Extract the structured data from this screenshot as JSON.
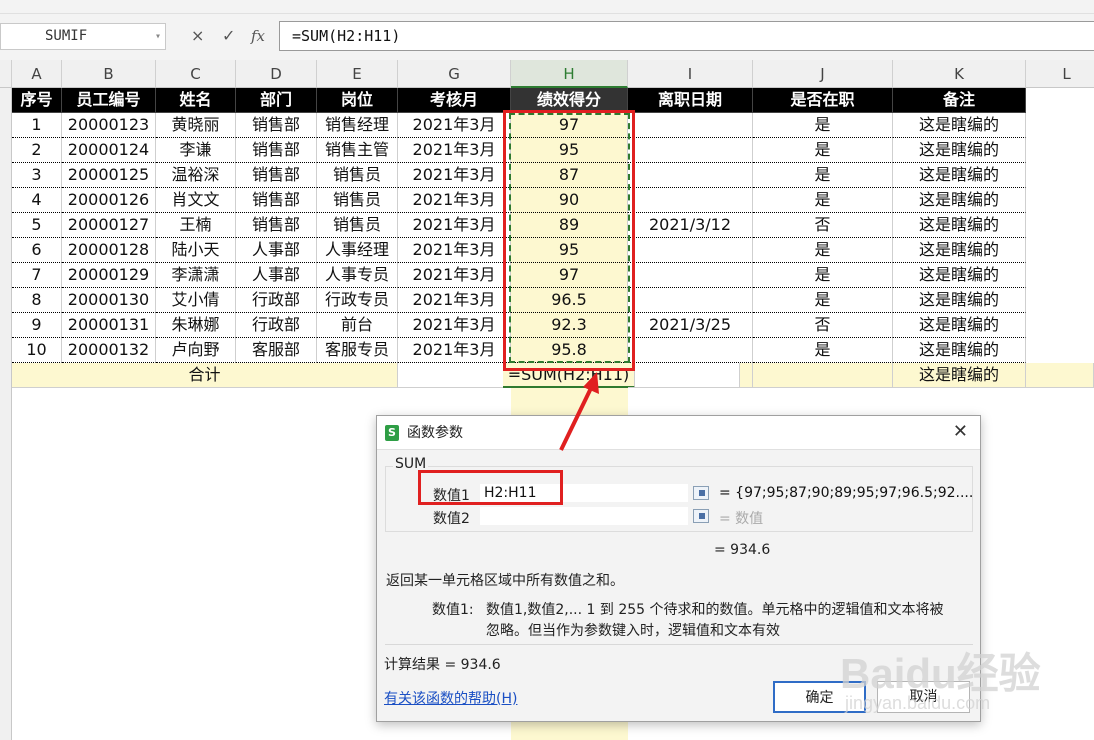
{
  "formula_bar": {
    "name_box": "SUMIF",
    "cancel_icon": "×",
    "enter_icon": "✓",
    "fx_icon": "fx",
    "formula": "=SUM(H2:H11)"
  },
  "columns": [
    "A",
    "B",
    "C",
    "D",
    "E",
    "G",
    "H",
    "I",
    "J",
    "K",
    "L"
  ],
  "headers": [
    "序号",
    "员工编号",
    "姓名",
    "部门",
    "岗位",
    "考核月",
    "绩效得分",
    "离职日期",
    "是否在职",
    "备注"
  ],
  "rows": [
    [
      "1",
      "20000123",
      "黄晓丽",
      "销售部",
      "销售经理",
      "2021年3月",
      "97",
      "",
      "是",
      "这是瞎编的"
    ],
    [
      "2",
      "20000124",
      "李谦",
      "销售部",
      "销售主管",
      "2021年3月",
      "95",
      "",
      "是",
      "这是瞎编的"
    ],
    [
      "3",
      "20000125",
      "温裕深",
      "销售部",
      "销售员",
      "2021年3月",
      "87",
      "",
      "是",
      "这是瞎编的"
    ],
    [
      "4",
      "20000126",
      "肖文文",
      "销售部",
      "销售员",
      "2021年3月",
      "90",
      "",
      "是",
      "这是瞎编的"
    ],
    [
      "5",
      "20000127",
      "王楠",
      "销售部",
      "销售员",
      "2021年3月",
      "89",
      "2021/3/12",
      "否",
      "这是瞎编的"
    ],
    [
      "6",
      "20000128",
      "陆小天",
      "人事部",
      "人事经理",
      "2021年3月",
      "95",
      "",
      "是",
      "这是瞎编的"
    ],
    [
      "7",
      "20000129",
      "李潇潇",
      "人事部",
      "人事专员",
      "2021年3月",
      "97",
      "",
      "是",
      "这是瞎编的"
    ],
    [
      "8",
      "20000130",
      "艾小倩",
      "行政部",
      "行政专员",
      "2021年3月",
      "96.5",
      "",
      "是",
      "这是瞎编的"
    ],
    [
      "9",
      "20000131",
      "朱琳娜",
      "行政部",
      "前台",
      "2021年3月",
      "92.3",
      "2021/3/25",
      "否",
      "这是瞎编的"
    ],
    [
      "10",
      "20000132",
      "卢向野",
      "客服部",
      "客服专员",
      "2021年3月",
      "95.8",
      "",
      "是",
      "这是瞎编的"
    ]
  ],
  "total_row": {
    "label": "合计",
    "formula": "=SUM(H2:H11)",
    "note": "这是瞎编的"
  },
  "dialog": {
    "title": "函数参数",
    "close_icon": "✕",
    "function_name": "SUM",
    "param1_label": "数值1",
    "param1_value": "H2:H11",
    "param1_result": "= {97;95;87;90;89;95;97;96.5;92....",
    "param2_label": "数值2",
    "param2_value": "",
    "param2_result": "= 数值",
    "formula_result_inline": "= 934.6",
    "description": "返回某一单元格区域中所有数值之和。",
    "param_help_label": "数值1:",
    "param_help_line1": "数值1,数值2,... 1 到 255 个待求和的数值。单元格中的逻辑值和文本将被",
    "param_help_line2": "忽略。但当作为参数键入时，逻辑值和文本有效",
    "calc_result": "计算结果 = 934.6",
    "help_link": "有关该函数的帮助(H)",
    "ok_button": "确定",
    "cancel_button": "取消"
  },
  "watermark": {
    "brand": "Baidu经验",
    "url": "jingyan.baidu.com"
  },
  "colors": {
    "header_bg": "#000000",
    "highlight": "#fdf8d0",
    "annotation_red": "#e02020",
    "selection_green": "#2f7a2f"
  }
}
